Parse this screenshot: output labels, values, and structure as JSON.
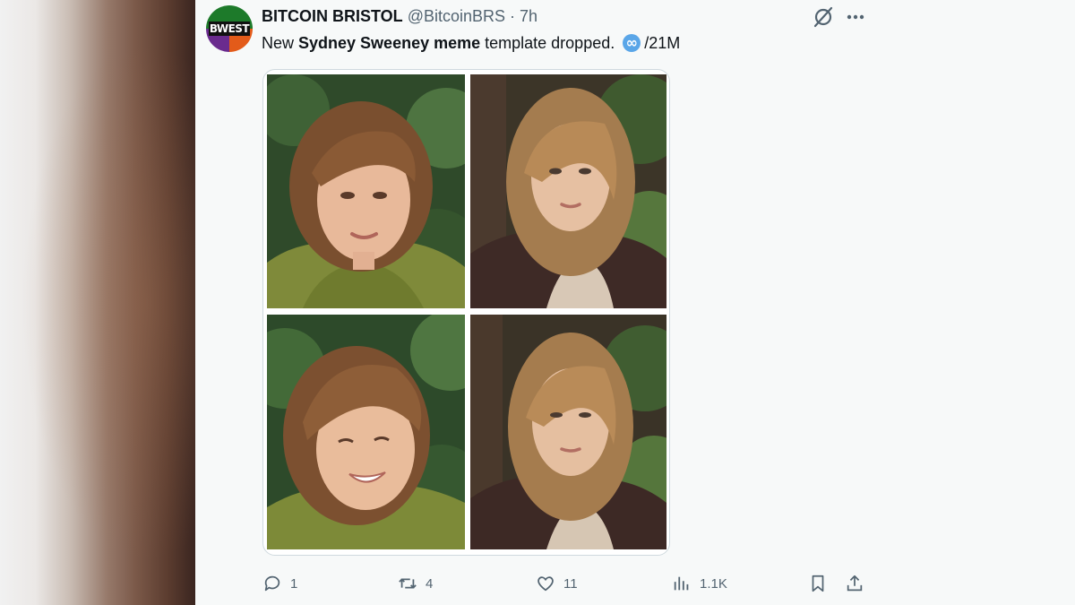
{
  "tweet": {
    "author_name": "BITCOIN BRISTOL",
    "handle": "@BitcoinBRS",
    "separator": "·",
    "time": "7h",
    "avatar_text": "BWEST",
    "text_before": "New ",
    "text_bold": "Sydney Sweeney meme",
    "text_after": " template dropped.",
    "text_suffix": "/21M",
    "emoji_icon": "infinity-emoji-icon"
  },
  "media": {
    "layout": "2x2 grid",
    "panels": [
      "panel-1",
      "panel-2",
      "panel-3",
      "panel-4"
    ]
  },
  "actions": {
    "replies": "1",
    "reposts": "4",
    "likes": "11",
    "views": "1.1K"
  },
  "icons": {
    "grok": "grok-icon",
    "more": "more-icon",
    "reply": "reply-icon",
    "repost": "repost-icon",
    "like": "heart-icon",
    "views": "views-chart-icon",
    "bookmark": "bookmark-icon",
    "share": "share-icon"
  },
  "colors": {
    "text_primary": "#0f1419",
    "text_secondary": "#536471",
    "border": "#cfd9de",
    "background": "#f7f9f9"
  }
}
